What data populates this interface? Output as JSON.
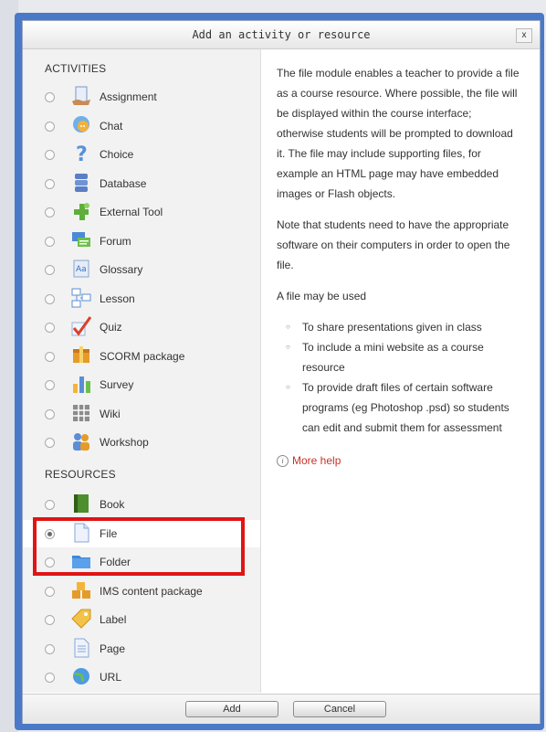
{
  "dialog": {
    "title": "Add an activity or resource",
    "close_label": "x"
  },
  "activities": {
    "heading": "ACTIVITIES",
    "items": [
      {
        "label": "Assignment",
        "icon": "assignment-icon"
      },
      {
        "label": "Chat",
        "icon": "chat-icon"
      },
      {
        "label": "Choice",
        "icon": "choice-icon"
      },
      {
        "label": "Database",
        "icon": "database-icon"
      },
      {
        "label": "External Tool",
        "icon": "external-tool-icon"
      },
      {
        "label": "Forum",
        "icon": "forum-icon"
      },
      {
        "label": "Glossary",
        "icon": "glossary-icon"
      },
      {
        "label": "Lesson",
        "icon": "lesson-icon"
      },
      {
        "label": "Quiz",
        "icon": "quiz-icon"
      },
      {
        "label": "SCORM package",
        "icon": "scorm-icon"
      },
      {
        "label": "Survey",
        "icon": "survey-icon"
      },
      {
        "label": "Wiki",
        "icon": "wiki-icon"
      },
      {
        "label": "Workshop",
        "icon": "workshop-icon"
      }
    ]
  },
  "resources": {
    "heading": "RESOURCES",
    "items": [
      {
        "label": "Book",
        "icon": "book-icon"
      },
      {
        "label": "File",
        "icon": "file-icon",
        "selected": true
      },
      {
        "label": "Folder",
        "icon": "folder-icon"
      },
      {
        "label": "IMS content package",
        "icon": "ims-package-icon"
      },
      {
        "label": "Label",
        "icon": "label-icon"
      },
      {
        "label": "Page",
        "icon": "page-icon"
      },
      {
        "label": "URL",
        "icon": "url-icon"
      }
    ]
  },
  "description": {
    "paragraphs": [
      "The file module enables a teacher to provide a file as a course resource. Where possible, the file will be displayed within the course interface; otherwise students will be prompted to download it. The file may include supporting files, for example an HTML page may have embedded images or Flash objects.",
      "Note that students need to have the appropriate software on their computers in order to open the file.",
      "A file may be used"
    ],
    "uses": [
      "To share presentations given in class",
      "To include a mini website as a course resource",
      "To provide draft files of certain software programs (eg Photoshop .psd) so students can edit and submit them for assessment"
    ],
    "more_help": "More help"
  },
  "footer": {
    "add_label": "Add",
    "cancel_label": "Cancel"
  },
  "colors": {
    "frame": "#4a79c8",
    "highlight": "#e01515",
    "link": "#c83227"
  }
}
